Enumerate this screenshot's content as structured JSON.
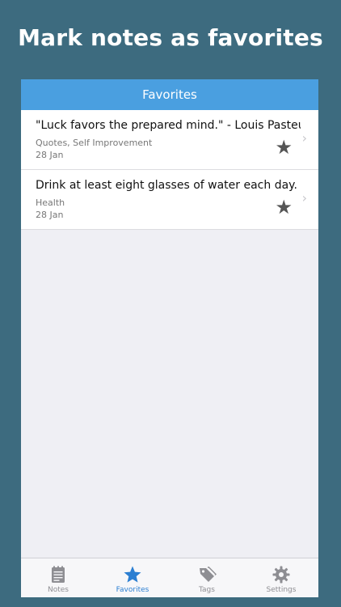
{
  "headline": "Mark notes as favorites",
  "nav": {
    "title": "Favorites"
  },
  "notes": [
    {
      "title": "\"Luck favors the prepared mind.\" - Louis Pasteur",
      "tags": "Quotes, Self Improvement",
      "date": "28 Jan",
      "favorite_icon": "star-icon",
      "disclosure_icon": "chevron-right-icon"
    },
    {
      "title": "Drink at least eight glasses of water each day.",
      "tags": "Health",
      "date": "28 Jan",
      "favorite_icon": "star-icon",
      "disclosure_icon": "chevron-right-icon"
    }
  ],
  "tabbar": {
    "tabs": [
      {
        "label": "Notes",
        "icon": "notepad-icon",
        "active": false
      },
      {
        "label": "Favorites",
        "icon": "star-icon",
        "active": true
      },
      {
        "label": "Tags",
        "icon": "tag-icon",
        "active": false
      },
      {
        "label": "Settings",
        "icon": "gear-icon",
        "active": false
      }
    ]
  },
  "colors": {
    "background": "#3d6b7f",
    "navbar": "#4a9fe0",
    "active_tab": "#2c7fd2",
    "inactive_tab": "#8e8e93"
  }
}
